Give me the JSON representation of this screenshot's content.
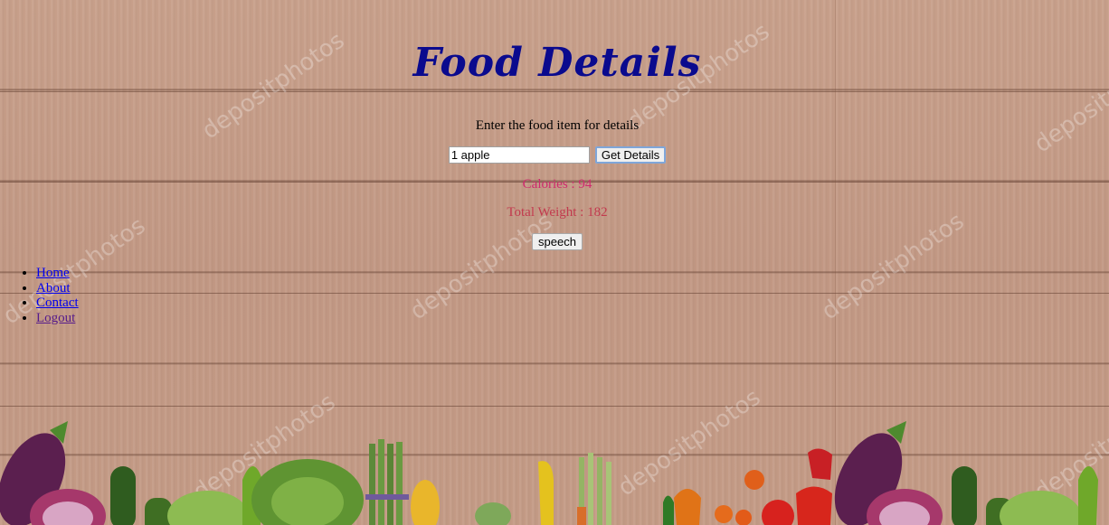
{
  "page": {
    "title": "Food Details",
    "prompt": "Enter the food item for details"
  },
  "search": {
    "value": "1 apple",
    "button_label": "Get Details"
  },
  "results": {
    "calories": "Calories : 94",
    "total_weight": "Total Weight : 182"
  },
  "speech": {
    "button_label": "speech"
  },
  "nav": {
    "items": [
      {
        "label": "Home"
      },
      {
        "label": "About"
      },
      {
        "label": "Contact"
      },
      {
        "label": "Logout"
      }
    ]
  },
  "background": {
    "watermark": "depositphotos"
  },
  "colors": {
    "title": "#0a0a8e",
    "calories": "#cf2a6e",
    "weight": "#c23a4e",
    "link": "#0000ee",
    "link_visited": "#551a8b"
  }
}
